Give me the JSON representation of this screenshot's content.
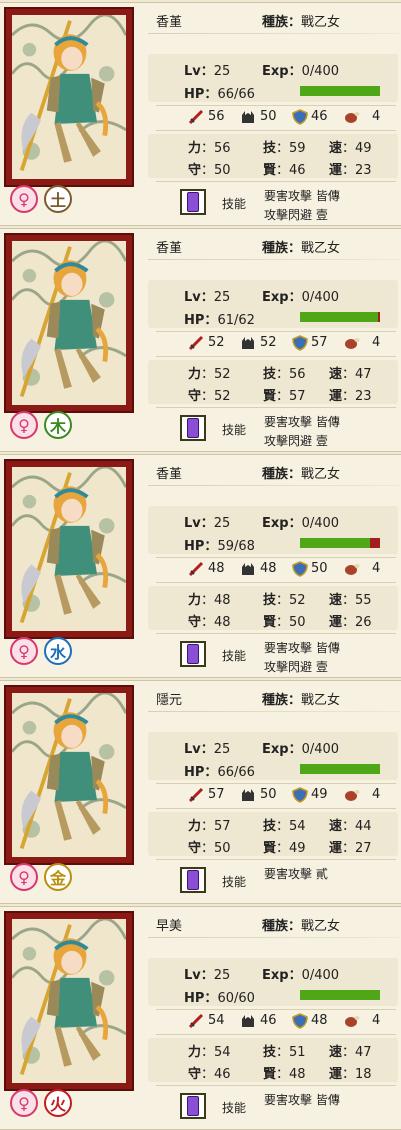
{
  "labels": {
    "race_label": "種族",
    "lv_label": "Lv",
    "exp_label": "Exp",
    "hp_label": "HP",
    "str_label": "力",
    "tec_label": "技",
    "spd_label": "速",
    "def_label": "守",
    "wis_label": "賢",
    "luk_label": "運",
    "skill_label": "技能"
  },
  "cards": [
    {
      "name": "香堇",
      "race": "戰乙女",
      "lv": "25",
      "exp": "0/400",
      "hp": "66/66",
      "hp_ratio": 1.0,
      "atk": "56",
      "matk": "50",
      "shield": "46",
      "meat": "4",
      "str": "56",
      "tec": "59",
      "spd": "49",
      "def": "50",
      "wis": "46",
      "luk": "23",
      "skill_lines": [
        "要害攻擊 皆傳",
        "攻擊閃避 壹"
      ],
      "element": "土",
      "element_color": "#7a5c2c",
      "gender": "♀"
    },
    {
      "name": "香堇",
      "race": "戰乙女",
      "lv": "25",
      "exp": "0/400",
      "hp": "61/62",
      "hp_ratio": 0.98,
      "atk": "52",
      "matk": "52",
      "shield": "57",
      "meat": "4",
      "str": "52",
      "tec": "56",
      "spd": "47",
      "def": "52",
      "wis": "57",
      "luk": "23",
      "skill_lines": [
        "要害攻擊 皆傳",
        "攻擊閃避 壹"
      ],
      "element": "木",
      "element_color": "#3b8a1e",
      "gender": "♀"
    },
    {
      "name": "香堇",
      "race": "戰乙女",
      "lv": "25",
      "exp": "0/400",
      "hp": "59/68",
      "hp_ratio": 0.87,
      "atk": "48",
      "matk": "48",
      "shield": "50",
      "meat": "4",
      "str": "48",
      "tec": "52",
      "spd": "55",
      "def": "48",
      "wis": "50",
      "luk": "26",
      "skill_lines": [
        "要害攻擊 皆傳",
        "攻擊閃避 壹"
      ],
      "element": "水",
      "element_color": "#1d6fb8",
      "gender": "♀"
    },
    {
      "name": "隱元",
      "race": "戰乙女",
      "lv": "25",
      "exp": "0/400",
      "hp": "66/66",
      "hp_ratio": 1.0,
      "atk": "57",
      "matk": "50",
      "shield": "49",
      "meat": "4",
      "str": "57",
      "tec": "54",
      "spd": "44",
      "def": "50",
      "wis": "49",
      "luk": "27",
      "skill_lines": [
        "要害攻擊 貳"
      ],
      "element": "金",
      "element_color": "#b8900f",
      "gender": "♀"
    },
    {
      "name": "早美",
      "race": "戰乙女",
      "lv": "25",
      "exp": "0/400",
      "hp": "60/60",
      "hp_ratio": 1.0,
      "atk": "54",
      "matk": "46",
      "shield": "48",
      "meat": "4",
      "str": "54",
      "tec": "51",
      "spd": "47",
      "def": "46",
      "wis": "48",
      "luk": "18",
      "skill_lines": [
        "要害攻擊 皆傳"
      ],
      "element": "火",
      "element_color": "#c41d1d",
      "gender": "♀"
    }
  ]
}
